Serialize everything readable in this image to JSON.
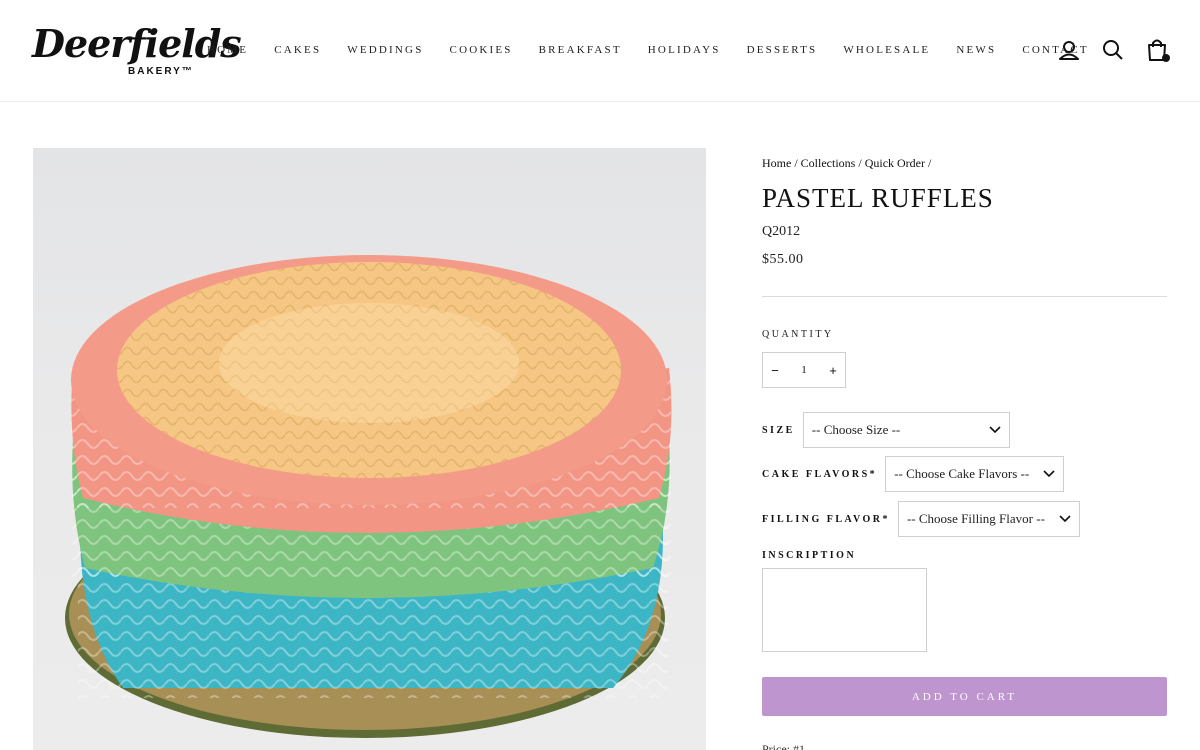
{
  "brand": {
    "name_script": "Deerfields",
    "name_sub": "BAKERY™"
  },
  "nav": [
    "HOME",
    "CAKES",
    "WEDDINGS",
    "COOKIES",
    "BREAKFAST",
    "HOLIDAYS",
    "DESSERTS",
    "WHOLESALE",
    "NEWS",
    "CONTACT"
  ],
  "header_icons": [
    "account-icon",
    "search-icon",
    "cart-icon"
  ],
  "breadcrumb": [
    "Home",
    "Collections",
    "Quick Order"
  ],
  "product": {
    "title": "PASTEL RUFFLES",
    "sku": "Q2012",
    "price": "$55.00"
  },
  "quantity": {
    "label": "QUANTITY",
    "minus": "−",
    "value": "1",
    "plus": "+"
  },
  "options": {
    "size": {
      "label": "SIZE",
      "value": "-- Choose Size --"
    },
    "cake_flavors": {
      "label": "CAKE FLAVORS*",
      "value": "-- Choose Cake Flavors --"
    },
    "filling_flavor": {
      "label": "FILLING FLAVOR*",
      "value": "-- Choose Filling Flavor --"
    }
  },
  "inscription": {
    "label": "INSCRIPTION",
    "value": ""
  },
  "add_to_cart": "ADD TO CART",
  "price_note": "Price: #1",
  "colors": {
    "button": "#bf95cf",
    "divider": "#dcdcdc",
    "text": "#111111"
  }
}
